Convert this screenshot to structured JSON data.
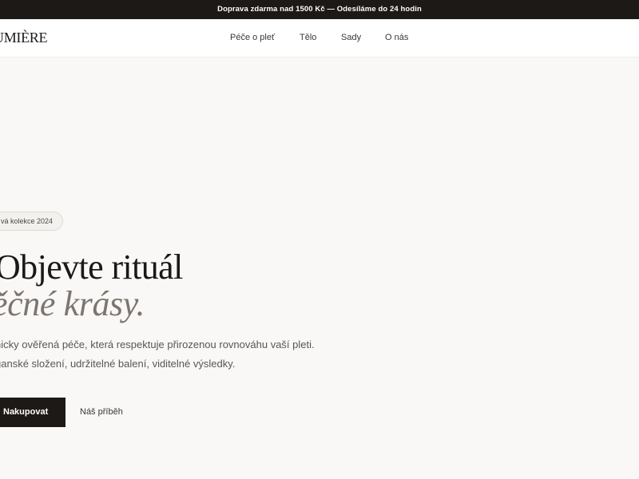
{
  "announcement": {
    "text": "Doprava zdarma nad 1500 Kč — Odesíláme do 24 hodin"
  },
  "header": {
    "logo": "UMIÈRE",
    "nav": [
      {
        "label": "Péče o pleť"
      },
      {
        "label": "Tělo"
      },
      {
        "label": "Sady"
      },
      {
        "label": "O nás"
      }
    ]
  },
  "hero": {
    "badge": "vá kolekce 2024",
    "headline_line1": "Objevte rituál",
    "headline_line2": "ěčné krásy.",
    "lead_line1": "nicky ověřená péče, která respektuje přirozenou rovnováhu vaší pleti.",
    "lead_line2": "ganské složení, udržitelné balení, viditelné výsledky.",
    "primary_button": "Nakupovat",
    "secondary_link": "Náš příběh"
  },
  "colors": {
    "announcement_bg": "#1c1917",
    "page_bg": "#f9f8f6",
    "accent_italic": "#7c7570",
    "primary_button_bg": "#1c1917"
  }
}
